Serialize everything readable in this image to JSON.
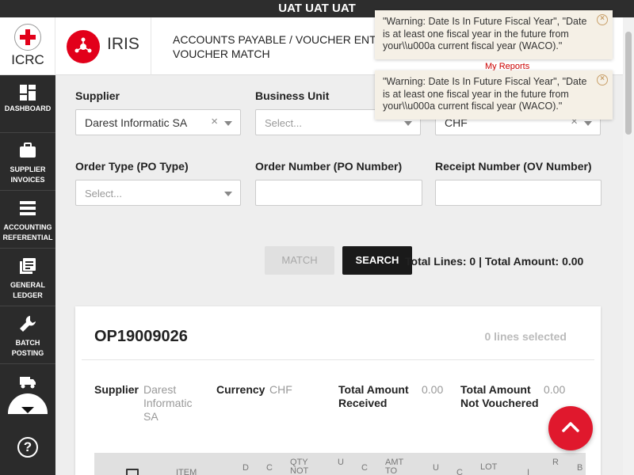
{
  "env_banner": "UAT UAT UAT",
  "header": {
    "org_name": "ICRC",
    "app_name": "IRIS",
    "breadcrumb_line1": "ACCOUNTS PAYABLE / VOUCHER ENT",
    "breadcrumb_line2": "VOUCHER MATCH",
    "my_reports": "My Reports"
  },
  "sidebar": {
    "items": [
      {
        "label": "DASHBOARD",
        "icon": "dashboard-icon"
      },
      {
        "label": "SUPPLIER INVOICES",
        "icon": "briefcase-icon"
      },
      {
        "label": "ACCOUNTING REFERENTIAL",
        "icon": "list-icon"
      },
      {
        "label": "GENERAL LEDGER",
        "icon": "ledger-icon"
      },
      {
        "label": "BATCH POSTING",
        "icon": "wrench-icon"
      },
      {
        "label": "",
        "icon": "truck-icon"
      }
    ],
    "help": "?"
  },
  "form": {
    "supplier": {
      "label": "Supplier",
      "value": "Darest Informatic SA"
    },
    "business_unit": {
      "label": "Business Unit",
      "placeholder": "Select..."
    },
    "currency": {
      "value": "CHF"
    },
    "order_type": {
      "label": "Order Type (PO Type)",
      "placeholder": "Select..."
    },
    "order_number": {
      "label": "Order Number (PO Number)",
      "value": ""
    },
    "receipt_number": {
      "label": "Receipt Number (OV Number)",
      "value": ""
    }
  },
  "actions": {
    "match_label": "MATCH",
    "search_label": "SEARCH",
    "totals": "Total Lines: 0 | Total Amount: 0.00"
  },
  "card": {
    "title": "OP19009026",
    "selected": "0 lines selected",
    "supplier_label": "Supplier",
    "supplier_value": "Darest Informatic SA",
    "currency_label": "Currency",
    "currency_value": "CHF",
    "received_label": "Total Amount Received",
    "received_value": "0.00",
    "not_vouchered_label": "Total Amount Not Vouchered",
    "not_vouchered_value": "0.00",
    "table_headers": [
      "ITEM",
      "D",
      "C",
      "QTY NOT",
      "U",
      "C",
      "AMT TO",
      "U",
      "C",
      "LOT",
      "I",
      "R",
      "B"
    ]
  },
  "toasts": [
    {
      "text": "\"Warning: Date Is In Future Fiscal Year\", \"Date is at least one fiscal year in the future from your\\\\u000a current fiscal year (WACO).\""
    },
    {
      "text": "\"Warning: Date Is In Future Fiscal Year\", \"Date is at least one fiscal year in the future from your\\\\u000a current fiscal year (WACO).\""
    }
  ],
  "colors": {
    "brand_red": "#e2001a",
    "sidebar_bg": "#2b2b2b",
    "toast_bg": "#f5f0e6"
  }
}
